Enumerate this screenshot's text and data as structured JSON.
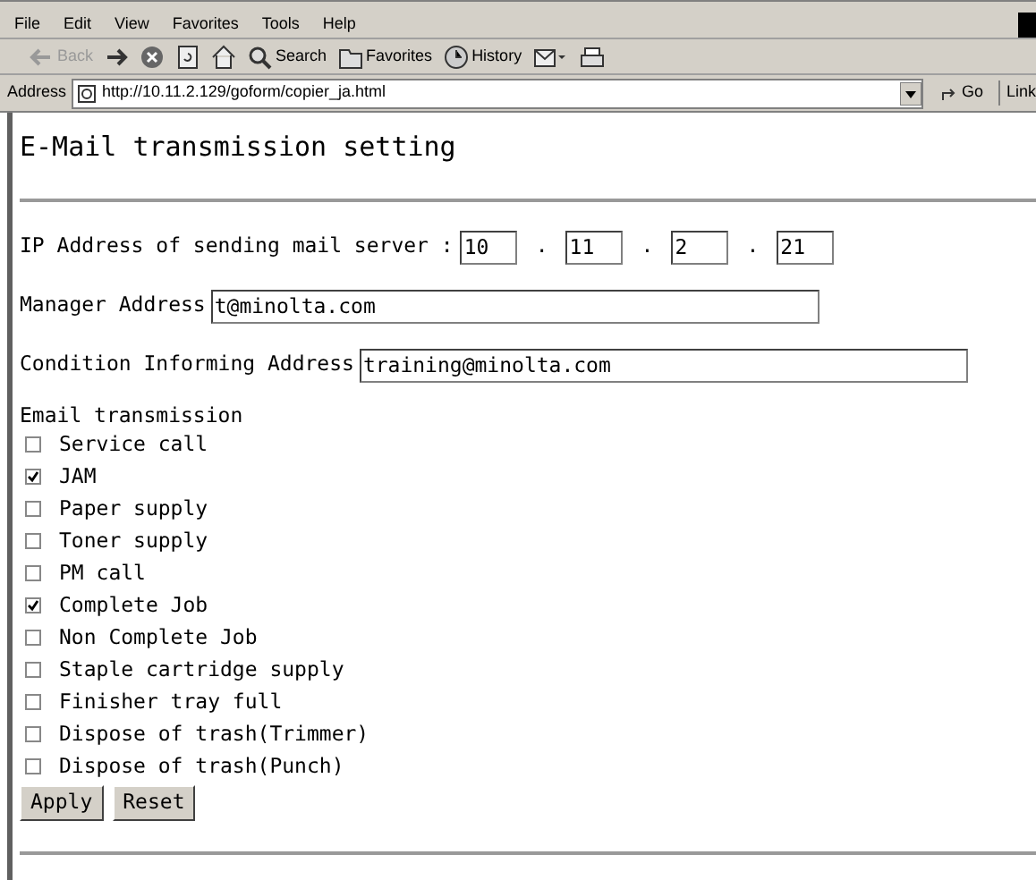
{
  "menu_bar": [
    "File",
    "Edit",
    "View",
    "Favorites",
    "Tools",
    "Help"
  ],
  "toolbar": [
    {
      "kind": "back",
      "label": "Back",
      "disabled": true
    },
    {
      "kind": "forward",
      "disabled": false
    },
    {
      "kind": "stop",
      "disabled": false
    },
    {
      "kind": "refresh",
      "disabled": false
    },
    {
      "kind": "home",
      "disabled": false
    },
    {
      "kind": "search",
      "label": "Search",
      "disabled": false
    },
    {
      "kind": "favorites",
      "label": "Favorites",
      "disabled": false
    },
    {
      "kind": "history",
      "label": "History",
      "disabled": false
    },
    {
      "kind": "mail",
      "disabled": false
    },
    {
      "kind": "print",
      "disabled": false
    }
  ],
  "address_bar": {
    "label": "Address",
    "url": "http://10.11.2.129/goform/copier_ja.html",
    "go": "Go",
    "links": "Link"
  },
  "page": {
    "title": "E-Mail transmission setting",
    "ip": {
      "label": "IP Address of sending mail server :",
      "octets": [
        "10",
        "11",
        "2",
        "21"
      ],
      "separator": "."
    },
    "fields": [
      {
        "label": "Manager Address",
        "value": "t@minolta.com"
      },
      {
        "label": "Condition Informing Address",
        "value": "training@minolta.com"
      }
    ],
    "section": "Email transmission",
    "options": [
      {
        "label": "Service call",
        "checked": false
      },
      {
        "label": "JAM",
        "checked": true
      },
      {
        "label": "Paper supply",
        "checked": false
      },
      {
        "label": "Toner supply",
        "checked": false
      },
      {
        "label": "PM call",
        "checked": false
      },
      {
        "label": "Complete Job",
        "checked": true
      },
      {
        "label": "Non Complete Job",
        "checked": false
      },
      {
        "label": "Staple cartridge supply",
        "checked": false
      },
      {
        "label": "Finisher tray full",
        "checked": false
      },
      {
        "label": "Dispose of trash(Trimmer)",
        "checked": false
      },
      {
        "label": "Dispose of trash(Punch)",
        "checked": false
      }
    ],
    "buttons": [
      "Apply",
      "Reset"
    ]
  }
}
